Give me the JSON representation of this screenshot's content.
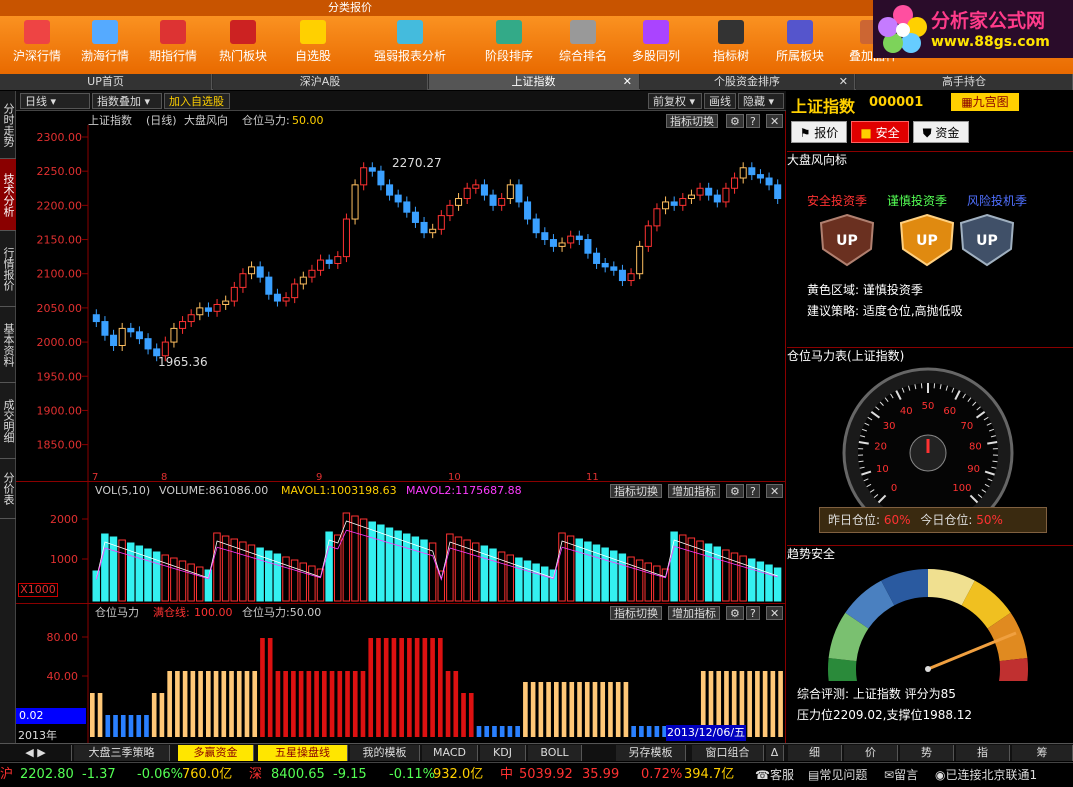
{
  "topbar": {
    "category": "分类报价",
    "buttons": [
      "沪深行情",
      "渤海行情",
      "期指行情",
      "热门板块",
      "自选股",
      "强弱报表分析",
      "阶段排序",
      "综合排名",
      "多股同列",
      "指标树",
      "所属板块",
      "叠加品种"
    ],
    "logo_title": "分析家公式网",
    "logo_url": "www.88gs.com"
  },
  "tabs": [
    "UP首页",
    "深沪A股",
    "上证指数",
    "个股资金排序",
    "高手持仓"
  ],
  "side_tabs": [
    "分时走势",
    "技术分析",
    "行情报价",
    "基本资料",
    "成交明细",
    "分价表"
  ],
  "toolbar": {
    "period": "日线",
    "overlay": "指数叠加",
    "add_fav": "加入自选股",
    "fq": "前复权",
    "draw": "画线",
    "hide": "隐藏"
  },
  "main_chart": {
    "title": "上证指数",
    "period": "(日线)",
    "subtitle": "大盘风向",
    "power_label": "仓位马力:",
    "power_value": "50.00",
    "switch_btn": "指标切换",
    "high_label": "2270.27",
    "low_label": "1965.36"
  },
  "vol_chart": {
    "label": "VOL(5,10)",
    "volume": "VOLUME:861086.00",
    "mavol1": "MAVOL1:1003198.63",
    "mavol2": "MAVOL2:1175687.88",
    "unit": "X1000",
    "switch_btn": "指标切换",
    "add_btn": "增加指标"
  },
  "pos_chart": {
    "label": "仓位马力",
    "full_label": "满仓线:",
    "full_value": "100.00",
    "power": "仓位马力:50.00",
    "value_tag": "0.02",
    "date_tag": "2013/12/06/五",
    "year": "2013年",
    "switch_btn": "指标切换",
    "add_btn": "增加指标"
  },
  "chart_data": [
    {
      "type": "candlestick",
      "title": "上证指数 (日线)",
      "ylim": [
        1800,
        2300
      ],
      "yticks": [
        "2300.00",
        "2250.00",
        "2200.00",
        "2150.00",
        "2100.00",
        "2050.00",
        "2000.00",
        "1950.00",
        "1900.00",
        "1850.00"
      ],
      "xticks": [
        "7",
        "8",
        "9",
        "10",
        "11"
      ],
      "annotations": [
        {
          "text": "2270.27"
        },
        {
          "text": "1965.36"
        }
      ],
      "close": [
        2030,
        2010,
        1995,
        2020,
        2015,
        2005,
        1990,
        1980,
        2000,
        2020,
        2030,
        2040,
        2050,
        2045,
        2055,
        2060,
        2080,
        2100,
        2110,
        2095,
        2070,
        2060,
        2065,
        2085,
        2095,
        2105,
        2120,
        2115,
        2125,
        2180,
        2230,
        2255,
        2250,
        2230,
        2215,
        2205,
        2190,
        2175,
        2160,
        2165,
        2185,
        2200,
        2210,
        2225,
        2230,
        2215,
        2200,
        2210,
        2230,
        2205,
        2180,
        2160,
        2150,
        2140,
        2145,
        2155,
        2150,
        2130,
        2115,
        2110,
        2105,
        2090,
        2100,
        2140,
        2170,
        2195,
        2205,
        2200,
        2210,
        2215,
        2225,
        2215,
        2205,
        2225,
        2240,
        2255,
        2245,
        2240,
        2230,
        2210
      ]
    },
    {
      "type": "bar",
      "title": "VOL(5,10)",
      "ylim": [
        0,
        2500
      ],
      "yticks": [
        "2000",
        "1000"
      ]
    },
    {
      "type": "bar",
      "title": "仓位马力",
      "ylim": [
        0,
        100
      ],
      "yticks": [
        "80.00",
        "40.00"
      ]
    }
  ],
  "right": {
    "name": "上证指数",
    "code": "000001",
    "grid_btn": "九宫图",
    "btn_quote": "报价",
    "btn_safe": "安全",
    "btn_fund": "资金",
    "sec1": "大盘风向标",
    "seasons": [
      "安全投资季",
      "谨慎投资季",
      "风险投机季"
    ],
    "zone": "黄色区域:  谨慎投资季",
    "strategy": "建议策略:  适度仓位,高抛低吸",
    "sec2": "仓位马力表(上证指数)",
    "gauge_ticks": [
      "0",
      "10",
      "20",
      "30",
      "40",
      "50",
      "60",
      "70",
      "80",
      "90",
      "100"
    ],
    "yesterday": "昨日仓位:",
    "yesterday_val": "60%",
    "today": "今日仓位:",
    "today_val": "50%",
    "sec3": "趋势安全",
    "rating": "综合评测:  上证指数  评分为85",
    "pressure": "压力位2209.02,支撑位1988.12"
  },
  "bottom_tabs": [
    "大盘三季策略",
    "多赢资金",
    "五星操盘线",
    "我的模板",
    "MACD",
    "KDJ",
    "BOLL",
    "另存模板",
    "窗口组合",
    "Δ",
    "细",
    "价",
    "势",
    "指",
    "筹"
  ],
  "status": {
    "sh_label": "沪",
    "sh_val": "2202.80",
    "sh_chg": "-1.37",
    "sh_pct": "-0.06%",
    "sh_amt": "760.0亿",
    "sz_label": "深",
    "sz_val": "8400.65",
    "sz_chg": "-9.15",
    "sz_pct": "-0.11%",
    "sz_amt": "932.0亿",
    "zh_label": "中",
    "zh_val": "5039.92",
    "zh_chg": "35.99",
    "zh_pct": "0.72%",
    "zh_amt": "394.7亿",
    "links": [
      "客服",
      "常见问题",
      "留言",
      "已连接北京联通1"
    ]
  },
  "colors": {
    "up": "#ff3232",
    "down": "#54ffff",
    "accent": "#ff7d00",
    "yellow": "#ffd000"
  }
}
